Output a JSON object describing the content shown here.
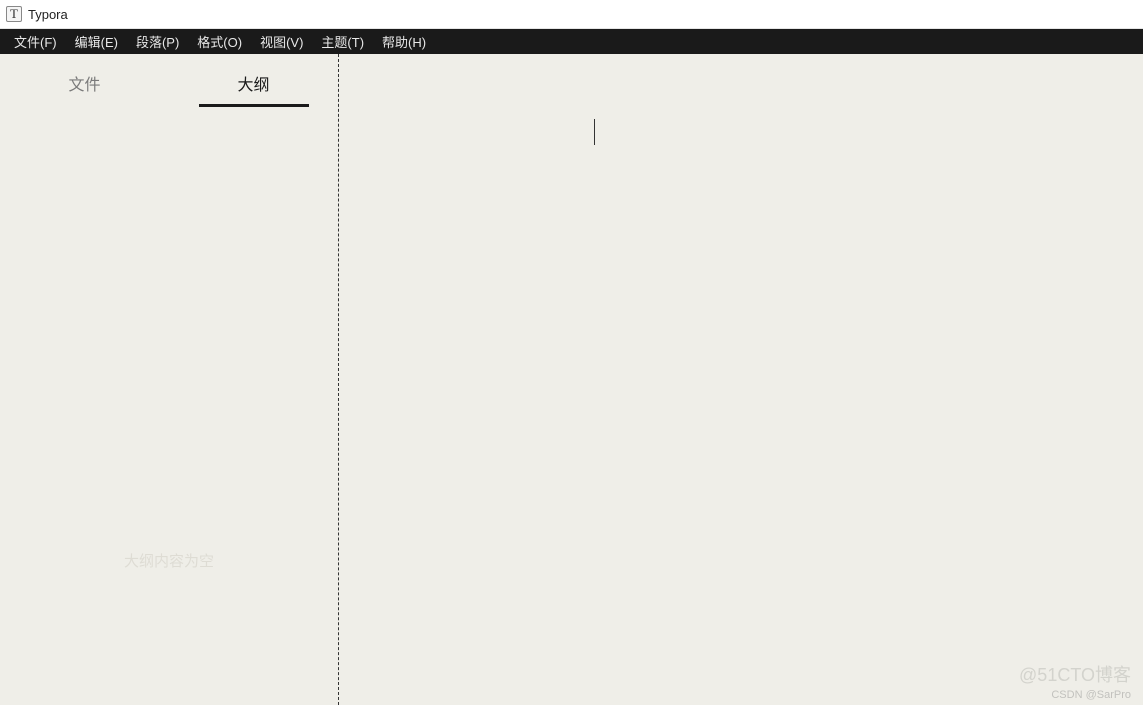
{
  "titlebar": {
    "icon_letter": "T",
    "title": "Typora"
  },
  "menubar": {
    "items": [
      "文件(F)",
      "编辑(E)",
      "段落(P)",
      "格式(O)",
      "视图(V)",
      "主题(T)",
      "帮助(H)"
    ]
  },
  "sidebar": {
    "tabs": {
      "files": "文件",
      "outline": "大纲"
    },
    "outline_empty_text": "大纲内容为空"
  },
  "watermarks": {
    "top": "@51CTO博客",
    "bottom": "CSDN @SarPro"
  }
}
